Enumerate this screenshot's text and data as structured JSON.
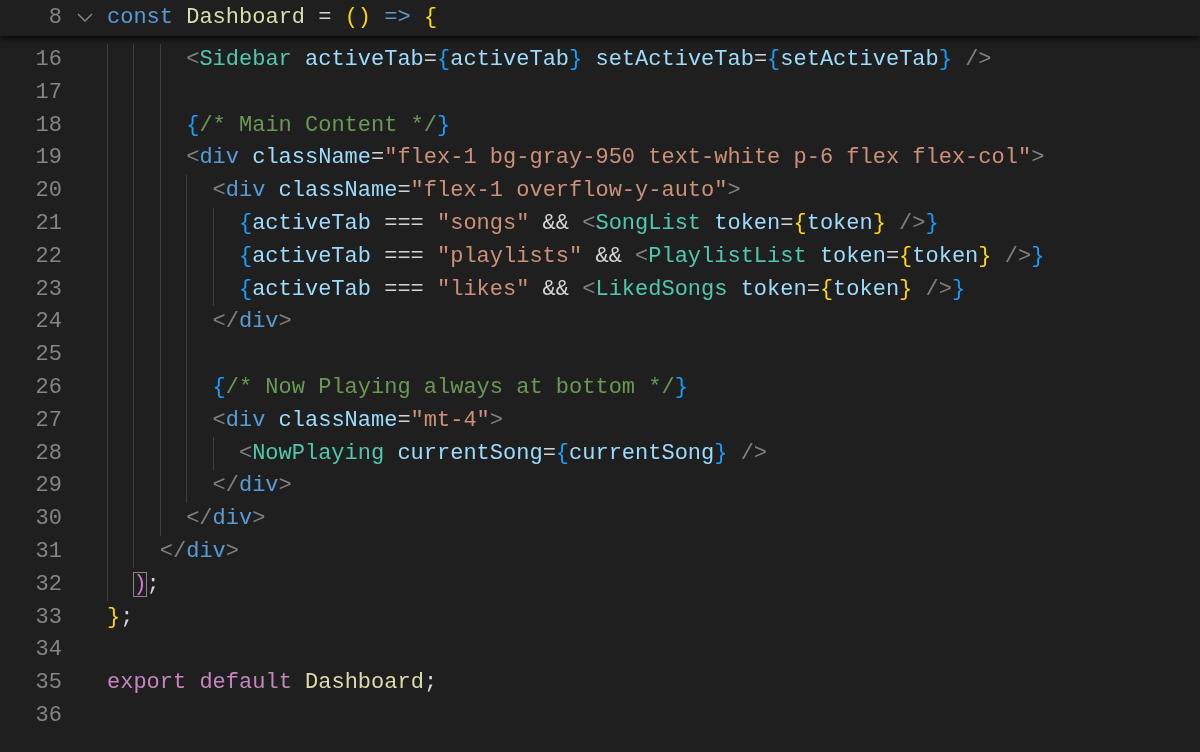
{
  "sticky_line": {
    "number": "8",
    "tokens": [
      {
        "kind": "kw",
        "text": "const "
      },
      {
        "kind": "fn",
        "text": "Dashboard"
      },
      {
        "kind": "op",
        "text": " = "
      },
      {
        "kind": "b1",
        "text": "()"
      },
      {
        "kind": "kw",
        "text": " => "
      },
      {
        "kind": "b1",
        "text": "{"
      }
    ]
  },
  "lines": [
    {
      "children": [
        {
          "children": [
            {
              "children": [
                {
                  "number": "16",
                  "tokens": [
                    {
                      "kind": "tag",
                      "text": "<"
                    },
                    {
                      "kind": "comp",
                      "text": "Sidebar"
                    },
                    {
                      "kind": "attr",
                      "text": " activeTab"
                    },
                    {
                      "kind": "op",
                      "text": "="
                    },
                    {
                      "kind": "b3",
                      "text": "{"
                    },
                    {
                      "kind": "var",
                      "text": "activeTab"
                    },
                    {
                      "kind": "b3",
                      "text": "}"
                    },
                    {
                      "kind": "attr",
                      "text": " setActiveTab"
                    },
                    {
                      "kind": "op",
                      "text": "="
                    },
                    {
                      "kind": "b3",
                      "text": "{"
                    },
                    {
                      "kind": "var",
                      "text": "setActiveTab"
                    },
                    {
                      "kind": "b3",
                      "text": "}"
                    },
                    {
                      "kind": "tag",
                      "text": " />"
                    }
                  ]
                },
                {
                  "number": "17"
                },
                {
                  "number": "18",
                  "tokens": [
                    {
                      "kind": "b3",
                      "text": "{"
                    },
                    {
                      "kind": "cmt",
                      "text": "/* Main Content */"
                    },
                    {
                      "kind": "b3",
                      "text": "}"
                    }
                  ]
                },
                {
                  "number": "19",
                  "tokens": [
                    {
                      "kind": "tag",
                      "text": "<"
                    },
                    {
                      "kind": "kw",
                      "text": "div"
                    },
                    {
                      "kind": "attr",
                      "text": " className"
                    },
                    {
                      "kind": "op",
                      "text": "="
                    },
                    {
                      "kind": "str",
                      "text": "\"flex-1 bg-gray-950 text-white p-6 flex flex-col\""
                    },
                    {
                      "kind": "tag",
                      "text": ">"
                    }
                  ],
                  "children": [
                    {
                      "number": "20",
                      "tokens": [
                        {
                          "kind": "tag",
                          "text": "<"
                        },
                        {
                          "kind": "kw",
                          "text": "div"
                        },
                        {
                          "kind": "attr",
                          "text": " className"
                        },
                        {
                          "kind": "op",
                          "text": "="
                        },
                        {
                          "kind": "str",
                          "text": "\"flex-1 overflow-y-auto\""
                        },
                        {
                          "kind": "tag",
                          "text": ">"
                        }
                      ],
                      "children": [
                        {
                          "number": "21",
                          "tokens": [
                            {
                              "kind": "b3",
                              "text": "{"
                            },
                            {
                              "kind": "var",
                              "text": "activeTab"
                            },
                            {
                              "kind": "op",
                              "text": " === "
                            },
                            {
                              "kind": "str",
                              "text": "\"songs\""
                            },
                            {
                              "kind": "op",
                              "text": " && "
                            },
                            {
                              "kind": "tag",
                              "text": "<"
                            },
                            {
                              "kind": "comp",
                              "text": "SongList"
                            },
                            {
                              "kind": "attr",
                              "text": " token"
                            },
                            {
                              "kind": "op",
                              "text": "="
                            },
                            {
                              "kind": "b1",
                              "text": "{"
                            },
                            {
                              "kind": "var",
                              "text": "token"
                            },
                            {
                              "kind": "b1",
                              "text": "}"
                            },
                            {
                              "kind": "tag",
                              "text": " />"
                            },
                            {
                              "kind": "b3",
                              "text": "}"
                            }
                          ]
                        },
                        {
                          "number": "22",
                          "tokens": [
                            {
                              "kind": "b3",
                              "text": "{"
                            },
                            {
                              "kind": "var",
                              "text": "activeTab"
                            },
                            {
                              "kind": "op",
                              "text": " === "
                            },
                            {
                              "kind": "str",
                              "text": "\"playlists\""
                            },
                            {
                              "kind": "op",
                              "text": " && "
                            },
                            {
                              "kind": "tag",
                              "text": "<"
                            },
                            {
                              "kind": "comp",
                              "text": "PlaylistList"
                            },
                            {
                              "kind": "attr",
                              "text": " token"
                            },
                            {
                              "kind": "op",
                              "text": "="
                            },
                            {
                              "kind": "b1",
                              "text": "{"
                            },
                            {
                              "kind": "var",
                              "text": "token"
                            },
                            {
                              "kind": "b1",
                              "text": "}"
                            },
                            {
                              "kind": "tag",
                              "text": " />"
                            },
                            {
                              "kind": "b3",
                              "text": "}"
                            }
                          ]
                        },
                        {
                          "number": "23",
                          "tokens": [
                            {
                              "kind": "b3",
                              "text": "{"
                            },
                            {
                              "kind": "var",
                              "text": "activeTab"
                            },
                            {
                              "kind": "op",
                              "text": " === "
                            },
                            {
                              "kind": "str",
                              "text": "\"likes\""
                            },
                            {
                              "kind": "op",
                              "text": " && "
                            },
                            {
                              "kind": "tag",
                              "text": "<"
                            },
                            {
                              "kind": "comp",
                              "text": "LikedSongs"
                            },
                            {
                              "kind": "attr",
                              "text": " token"
                            },
                            {
                              "kind": "op",
                              "text": "="
                            },
                            {
                              "kind": "b1",
                              "text": "{"
                            },
                            {
                              "kind": "var",
                              "text": "token"
                            },
                            {
                              "kind": "b1",
                              "text": "}"
                            },
                            {
                              "kind": "tag",
                              "text": " />"
                            },
                            {
                              "kind": "b3",
                              "text": "}"
                            }
                          ]
                        }
                      ]
                    },
                    {
                      "number": "24",
                      "tokens": [
                        {
                          "kind": "tag",
                          "text": "</"
                        },
                        {
                          "kind": "kw",
                          "text": "div"
                        },
                        {
                          "kind": "tag",
                          "text": ">"
                        }
                      ]
                    },
                    {
                      "number": "25"
                    },
                    {
                      "number": "26",
                      "tokens": [
                        {
                          "kind": "b3",
                          "text": "{"
                        },
                        {
                          "kind": "cmt",
                          "text": "/* Now Playing always at bottom */"
                        },
                        {
                          "kind": "b3",
                          "text": "}"
                        }
                      ]
                    },
                    {
                      "number": "27",
                      "tokens": [
                        {
                          "kind": "tag",
                          "text": "<"
                        },
                        {
                          "kind": "kw",
                          "text": "div"
                        },
                        {
                          "kind": "attr",
                          "text": " className"
                        },
                        {
                          "kind": "op",
                          "text": "="
                        },
                        {
                          "kind": "str",
                          "text": "\"mt-4\""
                        },
                        {
                          "kind": "tag",
                          "text": ">"
                        }
                      ],
                      "children": [
                        {
                          "number": "28",
                          "tokens": [
                            {
                              "kind": "tag",
                              "text": "<"
                            },
                            {
                              "kind": "comp",
                              "text": "NowPlaying"
                            },
                            {
                              "kind": "attr",
                              "text": " currentSong"
                            },
                            {
                              "kind": "op",
                              "text": "="
                            },
                            {
                              "kind": "b3",
                              "text": "{"
                            },
                            {
                              "kind": "var",
                              "text": "currentSong"
                            },
                            {
                              "kind": "b3",
                              "text": "}"
                            },
                            {
                              "kind": "tag",
                              "text": " />"
                            }
                          ]
                        }
                      ]
                    },
                    {
                      "number": "29",
                      "tokens": [
                        {
                          "kind": "tag",
                          "text": "</"
                        },
                        {
                          "kind": "kw",
                          "text": "div"
                        },
                        {
                          "kind": "tag",
                          "text": ">"
                        }
                      ]
                    }
                  ]
                },
                {
                  "number": "30",
                  "tokens": [
                    {
                      "kind": "tag",
                      "text": "</"
                    },
                    {
                      "kind": "kw",
                      "text": "div"
                    },
                    {
                      "kind": "tag",
                      "text": ">"
                    }
                  ]
                }
              ]
            },
            {
              "number": "31",
              "tokens": [
                {
                  "kind": "tag",
                  "text": "</"
                },
                {
                  "kind": "kw",
                  "text": "div"
                },
                {
                  "kind": "tag",
                  "text": ">"
                }
              ]
            }
          ]
        },
        {
          "number": "32",
          "tokens": [
            {
              "kind": "match",
              "text": ")"
            },
            {
              "kind": "op",
              "text": ";"
            }
          ]
        }
      ]
    },
    {
      "number": "33",
      "tokens": [
        {
          "kind": "b1",
          "text": "}"
        },
        {
          "kind": "op",
          "text": ";"
        }
      ]
    },
    {
      "number": "34"
    },
    {
      "number": "35",
      "tokens": [
        {
          "kind": "ctl",
          "text": "export default "
        },
        {
          "kind": "fn",
          "text": "Dashboard"
        },
        {
          "kind": "op",
          "text": ";"
        }
      ]
    },
    {
      "number": "36"
    }
  ]
}
